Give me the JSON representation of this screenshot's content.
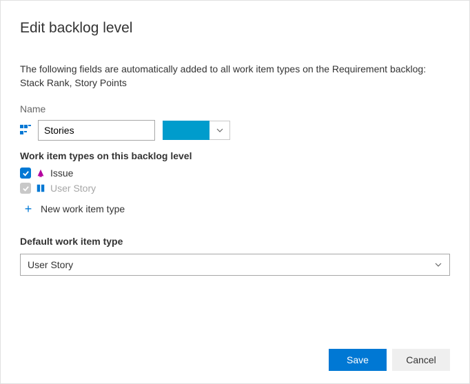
{
  "dialog": {
    "title": "Edit backlog level",
    "description": "The following fields are automatically added to all work item types on the Requirement backlog: Stack Rank, Story Points"
  },
  "nameSection": {
    "label": "Name",
    "value": "Stories",
    "colorSwatch": "#009ccc"
  },
  "witSection": {
    "label": "Work item types on this backlog level",
    "items": [
      {
        "label": "Issue",
        "checked": true,
        "disabled": false,
        "iconColor": "#b4009e"
      },
      {
        "label": "User Story",
        "checked": true,
        "disabled": true,
        "iconColor": "#0078d4"
      }
    ],
    "newLabel": "New work item type"
  },
  "defaultSection": {
    "label": "Default work item type",
    "value": "User Story"
  },
  "footer": {
    "save": "Save",
    "cancel": "Cancel"
  }
}
